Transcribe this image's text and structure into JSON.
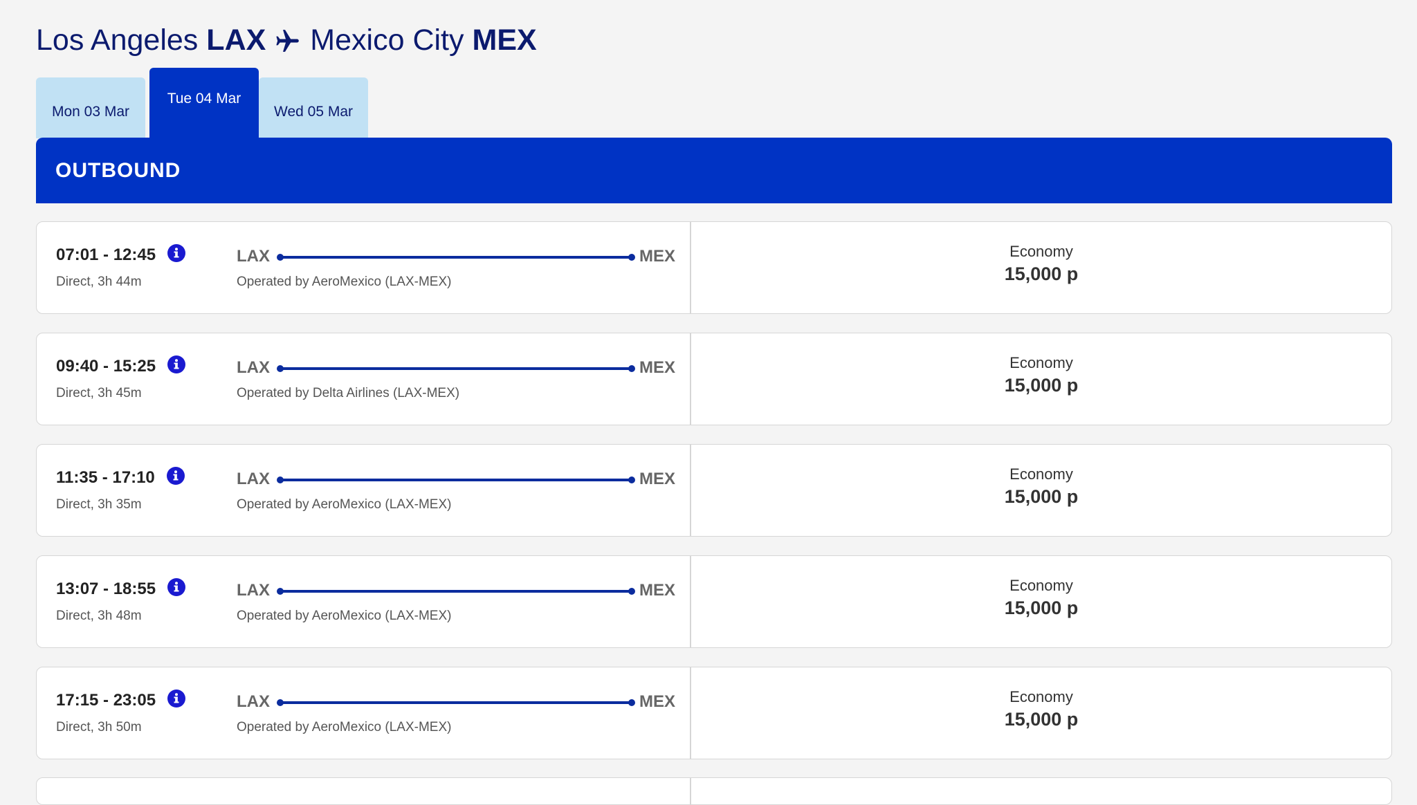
{
  "route": {
    "origin_city": "Los Angeles",
    "origin_code": "LAX",
    "destination_city": "Mexico City",
    "destination_code": "MEX",
    "separator_icon": "plane-icon"
  },
  "date_tabs": [
    {
      "label": "Mon 03 Mar",
      "active": false
    },
    {
      "label": "Tue 04 Mar",
      "active": true
    },
    {
      "label": "Wed 05 Mar",
      "active": false
    }
  ],
  "section": {
    "title": "OUTBOUND"
  },
  "flights": [
    {
      "times": "07:01 - 12:45",
      "duration": "Direct, 3h 44m",
      "from": "LAX",
      "to": "MEX",
      "operated_by": "Operated by AeroMexico (LAX-MEX)",
      "cabin": "Economy",
      "price": "15,000 p"
    },
    {
      "times": "09:40 - 15:25",
      "duration": "Direct, 3h 45m",
      "from": "LAX",
      "to": "MEX",
      "operated_by": "Operated by Delta Airlines (LAX-MEX)",
      "cabin": "Economy",
      "price": "15,000 p"
    },
    {
      "times": "11:35 - 17:10",
      "duration": "Direct, 3h 35m",
      "from": "LAX",
      "to": "MEX",
      "operated_by": "Operated by AeroMexico (LAX-MEX)",
      "cabin": "Economy",
      "price": "15,000 p"
    },
    {
      "times": "13:07 - 18:55",
      "duration": "Direct, 3h 48m",
      "from": "LAX",
      "to": "MEX",
      "operated_by": "Operated by AeroMexico (LAX-MEX)",
      "cabin": "Economy",
      "price": "15,000 p"
    },
    {
      "times": "17:15 - 23:05",
      "duration": "Direct, 3h 50m",
      "from": "LAX",
      "to": "MEX",
      "operated_by": "Operated by AeroMexico (LAX-MEX)",
      "cabin": "Economy",
      "price": "15,000 p"
    }
  ],
  "colors": {
    "brand_blue": "#0033c4",
    "tab_inactive": "#c1e1f4",
    "title_navy": "#0b1a6e",
    "line_blue": "#0b2c9e",
    "info_icon": "#1a1ad0"
  }
}
